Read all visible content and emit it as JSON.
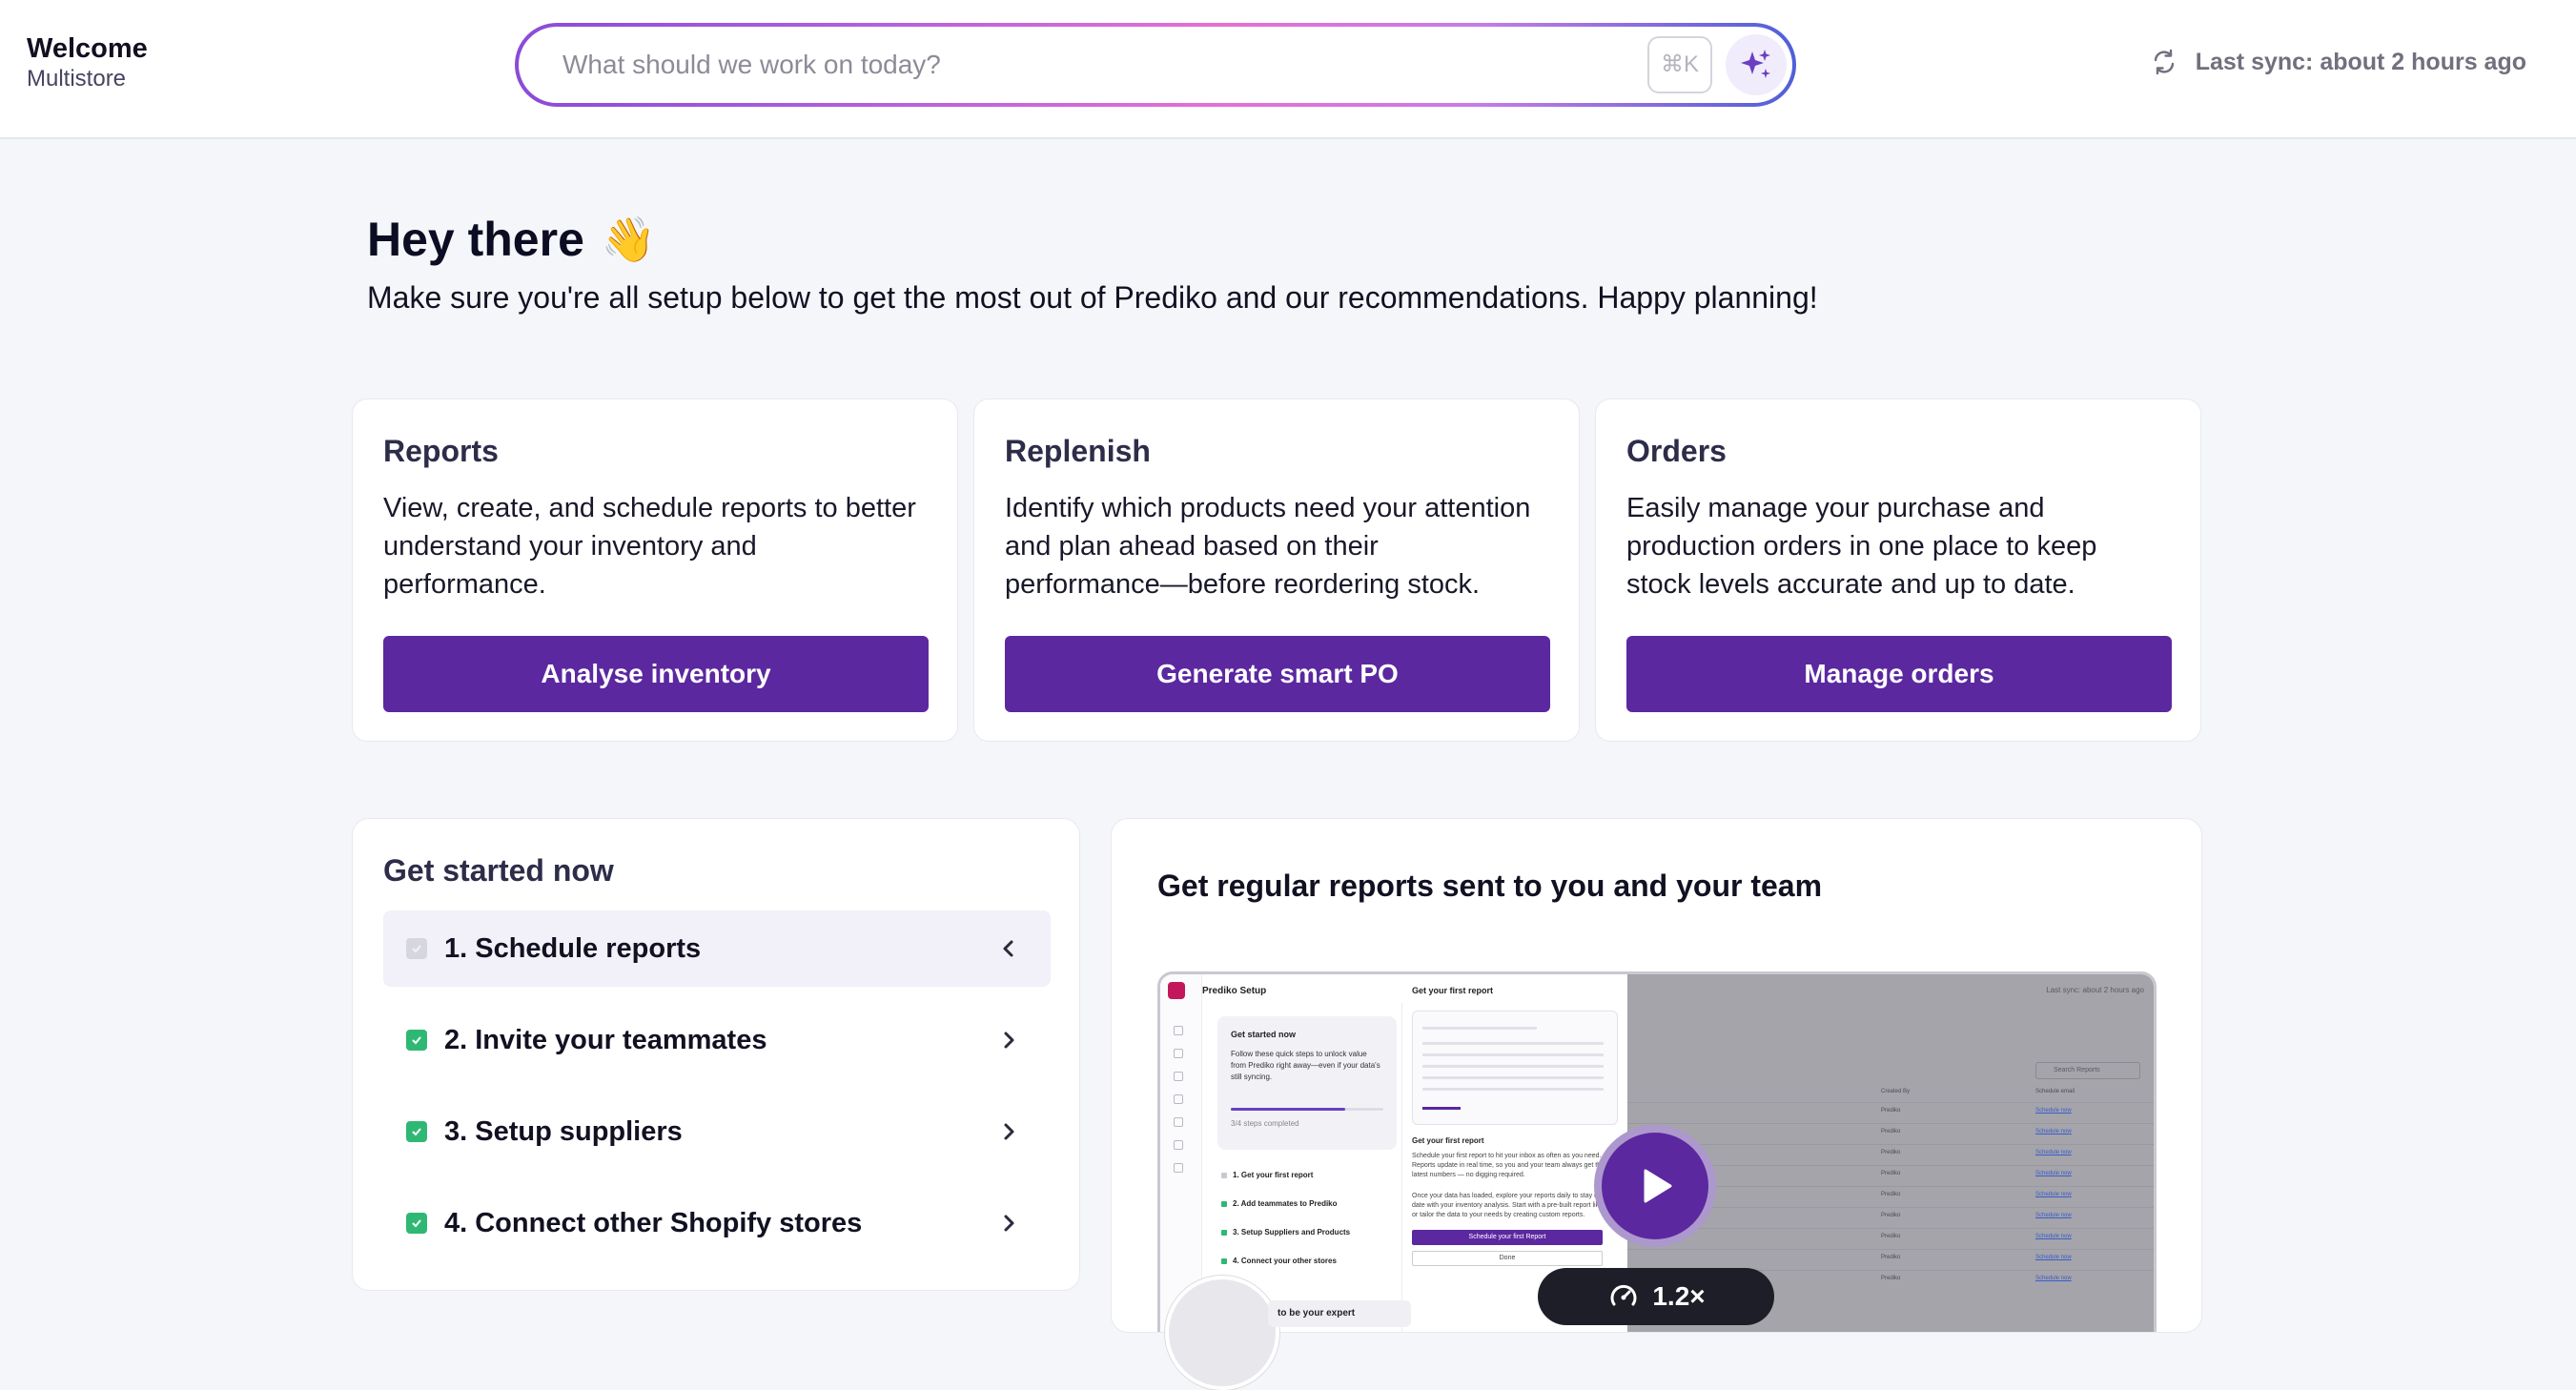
{
  "header": {
    "title": "Welcome",
    "store": "Multistore",
    "search_placeholder": "What should we work on today?",
    "shortcut": "⌘K",
    "sync_status": "Last sync: about 2 hours ago"
  },
  "hero": {
    "title": "Hey there",
    "emoji": "👋",
    "subtitle": "Make sure you're all setup below to get the most out of Prediko and our recommendations. Happy planning!"
  },
  "cards": [
    {
      "title": "Reports",
      "description": "View, create, and schedule reports to better understand your inventory and performance.",
      "button": "Analyse inventory"
    },
    {
      "title": "Replenish",
      "description": "Identify which products need your attention and plan ahead based on their performance—before reordering stock.",
      "button": "Generate smart PO"
    },
    {
      "title": "Orders",
      "description": "Easily manage your purchase and production orders in one place to keep stock levels accurate and up to date.",
      "button": "Manage orders"
    }
  ],
  "get_started": {
    "title": "Get started now",
    "steps": [
      {
        "label": "1. Schedule reports",
        "done": false,
        "expanded": true
      },
      {
        "label": "2. Invite your teammates",
        "done": true,
        "expanded": false
      },
      {
        "label": "3. Setup suppliers",
        "done": true,
        "expanded": false
      },
      {
        "label": "4. Connect other Shopify stores",
        "done": true,
        "expanded": false
      }
    ]
  },
  "video": {
    "title": "Get regular reports sent to you and your team",
    "speed": "1.2×",
    "preview": {
      "app_title": "Prediko Setup",
      "box_title": "Get started now",
      "box_text": "Follow these quick steps to unlock value from Prediko right away—even if your data's still syncing.",
      "progress": 0.75,
      "steps_completed": "3/4 steps completed",
      "steps": [
        "1. Get your first report",
        "2. Add teammates to Prediko",
        "3. Setup Suppliers and Products",
        "4. Connect your other stores"
      ],
      "content_title": "Get your first report",
      "content_sub": "Get your first report",
      "content_text": "Schedule your first report to hit your inbox as often as you need. Reports update in real time, so you and your team always get the latest numbers — no digging required.",
      "content_text2": "Once your data has loaded, explore your reports daily to stay up to date with your inventory analysis. Start with a pre-built report like ABC or tailor the data to your needs by creating custom reports.",
      "schedule_button": "Schedule your first Report",
      "done_button": "Done",
      "sync": "Last sync: about 2 hours ago",
      "search": "Search Reports",
      "col_created": "Created By",
      "col_schedule": "Schedule email",
      "creator": "Prediko",
      "schedule_link": "Schedule now",
      "rows": 9,
      "expert_caption": "to be your expert"
    }
  },
  "colors": {
    "primary": "#5b28a0",
    "done": "#2fb873",
    "background": "#f5f6fa"
  }
}
